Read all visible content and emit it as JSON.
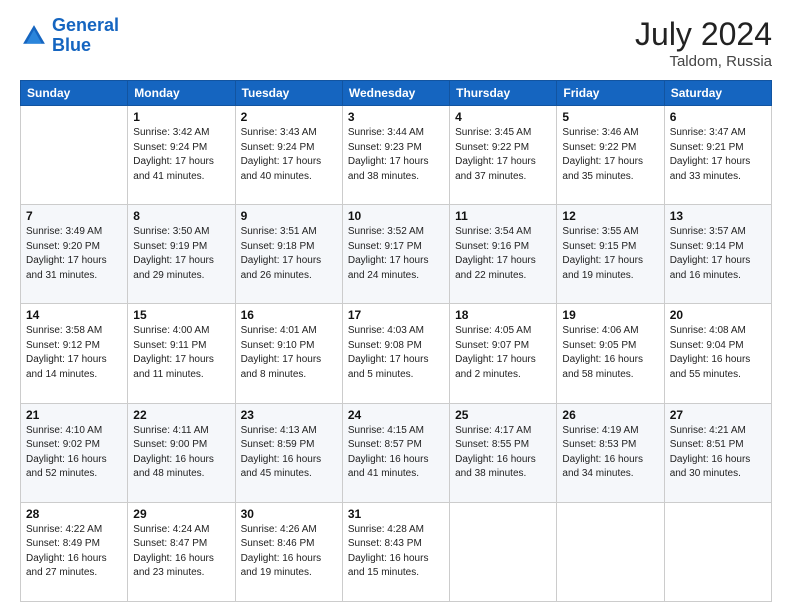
{
  "header": {
    "logo_line1": "General",
    "logo_line2": "Blue",
    "month_year": "July 2024",
    "location": "Taldom, Russia"
  },
  "days_of_week": [
    "Sunday",
    "Monday",
    "Tuesday",
    "Wednesday",
    "Thursday",
    "Friday",
    "Saturday"
  ],
  "weeks": [
    [
      {
        "day": "",
        "sunrise": "",
        "sunset": "",
        "daylight": ""
      },
      {
        "day": "1",
        "sunrise": "Sunrise: 3:42 AM",
        "sunset": "Sunset: 9:24 PM",
        "daylight": "Daylight: 17 hours and 41 minutes."
      },
      {
        "day": "2",
        "sunrise": "Sunrise: 3:43 AM",
        "sunset": "Sunset: 9:24 PM",
        "daylight": "Daylight: 17 hours and 40 minutes."
      },
      {
        "day": "3",
        "sunrise": "Sunrise: 3:44 AM",
        "sunset": "Sunset: 9:23 PM",
        "daylight": "Daylight: 17 hours and 38 minutes."
      },
      {
        "day": "4",
        "sunrise": "Sunrise: 3:45 AM",
        "sunset": "Sunset: 9:22 PM",
        "daylight": "Daylight: 17 hours and 37 minutes."
      },
      {
        "day": "5",
        "sunrise": "Sunrise: 3:46 AM",
        "sunset": "Sunset: 9:22 PM",
        "daylight": "Daylight: 17 hours and 35 minutes."
      },
      {
        "day": "6",
        "sunrise": "Sunrise: 3:47 AM",
        "sunset": "Sunset: 9:21 PM",
        "daylight": "Daylight: 17 hours and 33 minutes."
      }
    ],
    [
      {
        "day": "7",
        "sunrise": "Sunrise: 3:49 AM",
        "sunset": "Sunset: 9:20 PM",
        "daylight": "Daylight: 17 hours and 31 minutes."
      },
      {
        "day": "8",
        "sunrise": "Sunrise: 3:50 AM",
        "sunset": "Sunset: 9:19 PM",
        "daylight": "Daylight: 17 hours and 29 minutes."
      },
      {
        "day": "9",
        "sunrise": "Sunrise: 3:51 AM",
        "sunset": "Sunset: 9:18 PM",
        "daylight": "Daylight: 17 hours and 26 minutes."
      },
      {
        "day": "10",
        "sunrise": "Sunrise: 3:52 AM",
        "sunset": "Sunset: 9:17 PM",
        "daylight": "Daylight: 17 hours and 24 minutes."
      },
      {
        "day": "11",
        "sunrise": "Sunrise: 3:54 AM",
        "sunset": "Sunset: 9:16 PM",
        "daylight": "Daylight: 17 hours and 22 minutes."
      },
      {
        "day": "12",
        "sunrise": "Sunrise: 3:55 AM",
        "sunset": "Sunset: 9:15 PM",
        "daylight": "Daylight: 17 hours and 19 minutes."
      },
      {
        "day": "13",
        "sunrise": "Sunrise: 3:57 AM",
        "sunset": "Sunset: 9:14 PM",
        "daylight": "Daylight: 17 hours and 16 minutes."
      }
    ],
    [
      {
        "day": "14",
        "sunrise": "Sunrise: 3:58 AM",
        "sunset": "Sunset: 9:12 PM",
        "daylight": "Daylight: 17 hours and 14 minutes."
      },
      {
        "day": "15",
        "sunrise": "Sunrise: 4:00 AM",
        "sunset": "Sunset: 9:11 PM",
        "daylight": "Daylight: 17 hours and 11 minutes."
      },
      {
        "day": "16",
        "sunrise": "Sunrise: 4:01 AM",
        "sunset": "Sunset: 9:10 PM",
        "daylight": "Daylight: 17 hours and 8 minutes."
      },
      {
        "day": "17",
        "sunrise": "Sunrise: 4:03 AM",
        "sunset": "Sunset: 9:08 PM",
        "daylight": "Daylight: 17 hours and 5 minutes."
      },
      {
        "day": "18",
        "sunrise": "Sunrise: 4:05 AM",
        "sunset": "Sunset: 9:07 PM",
        "daylight": "Daylight: 17 hours and 2 minutes."
      },
      {
        "day": "19",
        "sunrise": "Sunrise: 4:06 AM",
        "sunset": "Sunset: 9:05 PM",
        "daylight": "Daylight: 16 hours and 58 minutes."
      },
      {
        "day": "20",
        "sunrise": "Sunrise: 4:08 AM",
        "sunset": "Sunset: 9:04 PM",
        "daylight": "Daylight: 16 hours and 55 minutes."
      }
    ],
    [
      {
        "day": "21",
        "sunrise": "Sunrise: 4:10 AM",
        "sunset": "Sunset: 9:02 PM",
        "daylight": "Daylight: 16 hours and 52 minutes."
      },
      {
        "day": "22",
        "sunrise": "Sunrise: 4:11 AM",
        "sunset": "Sunset: 9:00 PM",
        "daylight": "Daylight: 16 hours and 48 minutes."
      },
      {
        "day": "23",
        "sunrise": "Sunrise: 4:13 AM",
        "sunset": "Sunset: 8:59 PM",
        "daylight": "Daylight: 16 hours and 45 minutes."
      },
      {
        "day": "24",
        "sunrise": "Sunrise: 4:15 AM",
        "sunset": "Sunset: 8:57 PM",
        "daylight": "Daylight: 16 hours and 41 minutes."
      },
      {
        "day": "25",
        "sunrise": "Sunrise: 4:17 AM",
        "sunset": "Sunset: 8:55 PM",
        "daylight": "Daylight: 16 hours and 38 minutes."
      },
      {
        "day": "26",
        "sunrise": "Sunrise: 4:19 AM",
        "sunset": "Sunset: 8:53 PM",
        "daylight": "Daylight: 16 hours and 34 minutes."
      },
      {
        "day": "27",
        "sunrise": "Sunrise: 4:21 AM",
        "sunset": "Sunset: 8:51 PM",
        "daylight": "Daylight: 16 hours and 30 minutes."
      }
    ],
    [
      {
        "day": "28",
        "sunrise": "Sunrise: 4:22 AM",
        "sunset": "Sunset: 8:49 PM",
        "daylight": "Daylight: 16 hours and 27 minutes."
      },
      {
        "day": "29",
        "sunrise": "Sunrise: 4:24 AM",
        "sunset": "Sunset: 8:47 PM",
        "daylight": "Daylight: 16 hours and 23 minutes."
      },
      {
        "day": "30",
        "sunrise": "Sunrise: 4:26 AM",
        "sunset": "Sunset: 8:46 PM",
        "daylight": "Daylight: 16 hours and 19 minutes."
      },
      {
        "day": "31",
        "sunrise": "Sunrise: 4:28 AM",
        "sunset": "Sunset: 8:43 PM",
        "daylight": "Daylight: 16 hours and 15 minutes."
      },
      {
        "day": "",
        "sunrise": "",
        "sunset": "",
        "daylight": ""
      },
      {
        "day": "",
        "sunrise": "",
        "sunset": "",
        "daylight": ""
      },
      {
        "day": "",
        "sunrise": "",
        "sunset": "",
        "daylight": ""
      }
    ]
  ]
}
